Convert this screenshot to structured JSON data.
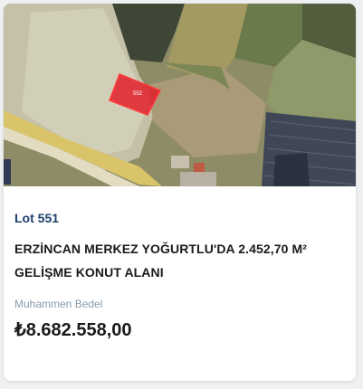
{
  "listing": {
    "image_alt": "satellite-parcel-map",
    "parcel_label": "552",
    "lot": "Lot 551",
    "title": "ERZİNCAN MERKEZ YOĞURTLU'DA 2.452,70 M² GELİŞME KONUT ALANI",
    "price_label": "Muhammen Bedel",
    "price": "₺8.682.558,00"
  },
  "colors": {
    "lot": "#1d3f6e",
    "parcel_highlight": "#e0202a",
    "price_label": "#8a9aa8"
  }
}
